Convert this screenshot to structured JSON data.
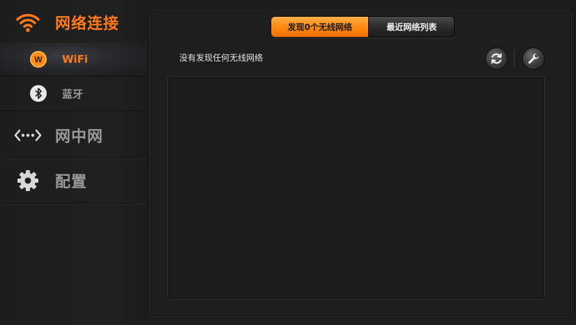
{
  "sidebar": {
    "network": {
      "label": "网络连接",
      "icon": "wifi-signal-icon"
    },
    "wifi": {
      "label": "WiFi",
      "icon": "wifi-badge-icon",
      "badge": "W"
    },
    "bluetooth": {
      "label": "蓝牙",
      "icon": "bluetooth-icon"
    },
    "mesh": {
      "label": "网中网",
      "icon": "network-dots-icon"
    },
    "settings": {
      "label": "配置",
      "icon": "gear-icon"
    }
  },
  "tabs": [
    {
      "label": "发现0个无线网络",
      "active": true
    },
    {
      "label": "最近网络列表",
      "active": false
    }
  ],
  "status": "没有发现任何无线网络",
  "toolbar": {
    "refresh_icon": "refresh-icon",
    "tools_icon": "wrench-icon"
  },
  "colors": {
    "accent": "#ff7a1a",
    "background": "#1b1b1b",
    "text_inactive": "#9a9a9a"
  }
}
